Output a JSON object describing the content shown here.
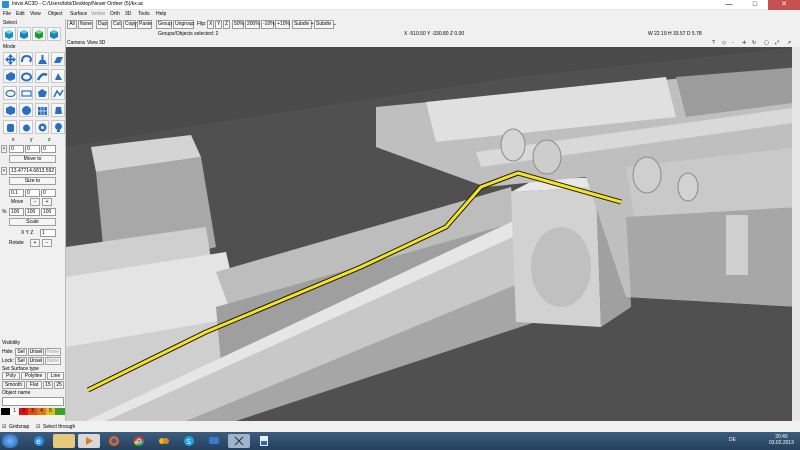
{
  "window": {
    "title": "Inivis AC3D - C:/Users/tobi/Desktop/Neuer Ordner (5)/kx.ac",
    "minimize": "—",
    "maximize": "□",
    "close": "✕"
  },
  "menu": [
    "File",
    "Edit",
    "View",
    "Object",
    "Surface",
    "Vertex",
    "Orth",
    "3D",
    "Tools",
    "Help"
  ],
  "left_panel": {
    "select_label": "Select",
    "mode_label": "Mode",
    "move_to_values": [
      "0",
      "0",
      "0"
    ],
    "move_to_label": "Move to",
    "size_to_value": "13.47714.6813.592",
    "size_to_label": "Size to",
    "move_values": [
      "0.1",
      "0",
      "0"
    ],
    "move_label": "Move",
    "move_minus": "−",
    "move_plus": "+",
    "scale_pct": "%",
    "scale_values": [
      "100",
      "100",
      "100"
    ],
    "scale_label": "Scale",
    "rotate_axes": "X Y Z",
    "rotate_axis_y": "Y",
    "rotate_value": "1",
    "rotate_label": "Rotate",
    "rotate_plus": "+",
    "rotate_minus": "−",
    "visibility_label": "Visibility",
    "hide_label": "Hide:",
    "lock_label": "Lock:",
    "sel": "Sel",
    "unsel": "Unsel",
    "none": "None",
    "set_surface_type": "Set Surface type",
    "poly": "Poly",
    "polyline": "Polyline",
    "line": "Line",
    "smooth": "Smooth",
    "flat": "Flat",
    "crease_values": [
      "15",
      "25"
    ],
    "object_name_label": "Object name",
    "palette_numbers": [
      "1",
      "2",
      "3",
      "4",
      "5"
    ]
  },
  "toolbar": {
    "all": "All",
    "none": "None",
    "dup": "Dup",
    "cut": "Cut",
    "copy": "Copy",
    "paste": "Paste",
    "group": "Group",
    "ungroup": "Ungroup",
    "flip_label": "Flip:",
    "flip_x": "X",
    "flip_y": "Y",
    "flip_z": "Z",
    "zoom_50": "50%",
    "zoom_200": "200%",
    "zoom_m10": "-10%",
    "zoom_p10": "+10%",
    "subdiv_plus": "Subdiv +",
    "subdiv_dd": "Subdiv ⌄"
  },
  "status": {
    "groups_selected": "Groups/Objects selected: 2",
    "coords": "X -510.50 Y -330.80 Z 0.00",
    "dims": "W 22.19 H 33.57 D 5.78"
  },
  "viewport": {
    "menu": [
      "Camera",
      "View",
      "3D"
    ],
    "controls": [
      "?",
      "◇",
      "◦",
      "✛",
      "↻",
      "▢",
      "⤢",
      "↗"
    ]
  },
  "bottom": {
    "gridsnap": "Gridsnap",
    "select_through": "Select through"
  },
  "taskbar": {
    "language": "DE",
    "time": "20:45",
    "date": "03.02.2013"
  }
}
